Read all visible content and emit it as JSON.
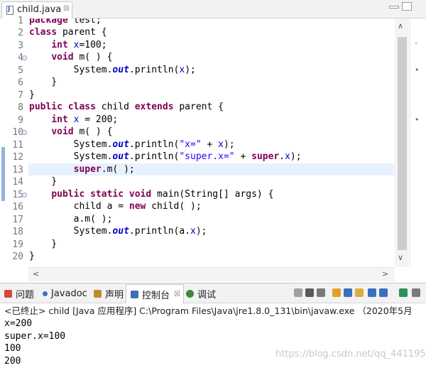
{
  "editor": {
    "tab": {
      "label": "child.java",
      "close": "☒"
    },
    "line_numbers": [
      "1",
      "2",
      "3",
      "4",
      "5",
      "6",
      "7",
      "8",
      "9",
      "10",
      "11",
      "12",
      "13",
      "14",
      "15",
      "16",
      "17",
      "18",
      "19",
      "20"
    ],
    "code": {
      "l1": {
        "kw1": "package",
        "rest": " test;"
      },
      "l2": {
        "kw1": "class",
        "rest": " parent {"
      },
      "l3": {
        "indent": "    ",
        "kw1": "int",
        "fld": " x",
        "rest": "=100;"
      },
      "l4": {
        "indent": "    ",
        "kw1": "void",
        "rest": " m( ) {"
      },
      "l5": {
        "indent": "        ",
        "a": "System.",
        "sfld": "out",
        "b": ".println(",
        "fld": "x",
        "c": ");"
      },
      "l6": {
        "text": "    }"
      },
      "l7": {
        "text": "}"
      },
      "l8": {
        "kw1": "public",
        "sp1": " ",
        "kw2": "class",
        "mid": " child ",
        "kw3": "extends",
        "rest": " parent {"
      },
      "l9": {
        "indent": "    ",
        "kw1": "int",
        "fld": " x",
        "rest": " = 200;"
      },
      "l10": {
        "indent": "    ",
        "kw1": "void",
        "rest": " m( ) {"
      },
      "l11": {
        "indent": "        ",
        "a": "System.",
        "sfld": "out",
        "b": ".println(",
        "str": "\"x=\"",
        "c": " + ",
        "fld": "x",
        "d": ");"
      },
      "l12": {
        "indent": "        ",
        "a": "System.",
        "sfld": "out",
        "b": ".println(",
        "str": "\"super.x=\"",
        "c": " + ",
        "kw1": "super",
        "d": ".",
        "fld": "x",
        "e": ");"
      },
      "l13": {
        "indent": "        ",
        "kw1": "super",
        "rest": ".m( );"
      },
      "l14": {
        "text": "    }"
      },
      "l15": {
        "indent": "    ",
        "kw1": "public",
        "sp1": " ",
        "kw2": "static",
        "sp2": " ",
        "kw3": "void",
        "rest": " main(String[] args) {"
      },
      "l16": {
        "indent": "        ",
        "a": "child a = ",
        "kw1": "new",
        "rest": " child( );"
      },
      "l17": {
        "text": "        a.m( );"
      },
      "l18": {
        "indent": "        ",
        "a": "System.",
        "sfld": "out",
        "b": ".println(a.",
        "fld": "x",
        "c": ");"
      },
      "l19": {
        "text": "    }"
      },
      "l20": {
        "text": "}"
      }
    },
    "scroll": {
      "up": "∧",
      "down": "∨",
      "left": "<",
      "right": ">"
    },
    "ruler": {
      "mark1": "-",
      "mark2": "•",
      "mark3": "•"
    }
  },
  "views": {
    "tabs": [
      {
        "label": "问题",
        "icon_color": "#d24b3a"
      },
      {
        "label": "Javadoc",
        "icon_color": "#3b6fb6"
      },
      {
        "label": "声明",
        "icon_color": "#c28a2e"
      },
      {
        "label": "控制台",
        "icon_color": "#3d6fb0",
        "close": "☒"
      },
      {
        "label": "调试",
        "icon_color": "#3a8a3a"
      }
    ],
    "toolbar_colors": [
      "#a0a0a0",
      "#5a5a5a",
      "#7a7a7a",
      "#e0a030",
      "#3a6fc0",
      "#d8b040",
      "#3a6fc0",
      "#3a6fc0",
      "#2f8f5a",
      "#7a7a7a"
    ],
    "console": {
      "header": "<已终止> child [Java 应用程序] C:\\Program Files\\Java\\jre1.8.0_131\\bin\\javaw.exe （2020年5月",
      "output": [
        "x=200",
        "super.x=100",
        "100",
        "200"
      ]
    },
    "watermark": "https://blog.csdn.net/qq_44119514"
  }
}
